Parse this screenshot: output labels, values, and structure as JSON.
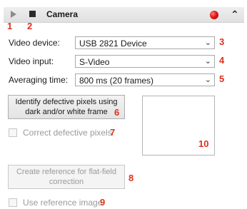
{
  "header": {
    "title": "Camera",
    "play_icon": "play-icon",
    "stop_icon": "stop-icon",
    "record_icon": "record-icon",
    "collapse_icon": "chevron-up-icon",
    "collapse_glyph": "≈"
  },
  "markers": {
    "m1": "1",
    "m2": "2",
    "m3": "3",
    "m4": "4",
    "m5": "5",
    "m6": "6",
    "m7": "7",
    "m8": "8",
    "m9": "9",
    "m10": "10"
  },
  "settings": {
    "video_device": {
      "label": "Video device:",
      "value": "USB 2821 Device"
    },
    "video_input": {
      "label": "Video input:",
      "value": "S-Video"
    },
    "averaging_time": {
      "label": "Averaging time:",
      "value": "800 ms (20 frames)"
    }
  },
  "buttons": {
    "identify_line1": "Identify defective pixels using",
    "identify_line2": "dark and/or white frame",
    "create_ref_line1": "Create reference for flat-field",
    "create_ref_line2": "correction"
  },
  "checkboxes": {
    "correct_defective": {
      "label": "Correct defective pixels",
      "checked": false,
      "enabled": false
    },
    "use_reference": {
      "label": "Use reference image",
      "checked": false,
      "enabled": false
    }
  },
  "colors": {
    "marker": "#e0301e",
    "record": "#e01818",
    "header_bg": "#e6e6e6"
  }
}
